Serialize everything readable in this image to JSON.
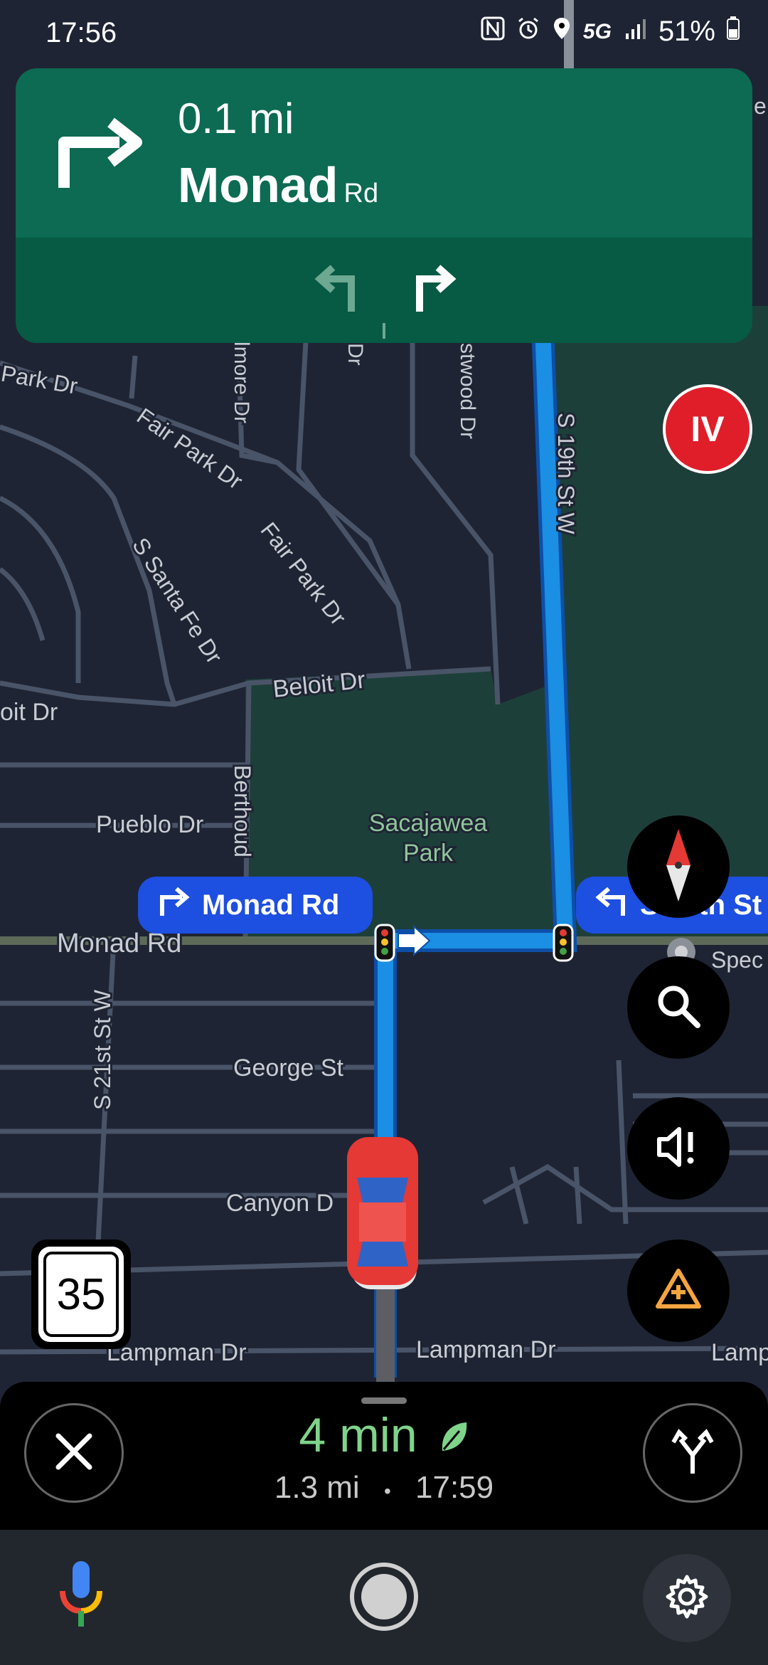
{
  "status_bar": {
    "time": "17:56",
    "network": "5G",
    "battery": "51%"
  },
  "navigation": {
    "distance": "0.1 mi",
    "street_name": "Monad",
    "street_suffix": "Rd"
  },
  "map": {
    "labels": {
      "park_dr": "Park Dr",
      "fair_park_dr_1": "Fair Park Dr",
      "fair_park_dr_2": "Fair Park Dr",
      "s_santa_fe_dr": "S Santa Fe Dr",
      "beloit_dr": "Beloit Dr",
      "beloit_dr_left": "oit Dr",
      "pueblo_dr": "Pueblo Dr",
      "berthoud": "Berthoud",
      "monad_rd": "Monad Rd",
      "s_21st_st_w": "S 21st St W",
      "george_st": "George St",
      "canyon_dr": "Canyon D",
      "lampman_dr_1": "Lampman Dr",
      "lampman_dr_2": "Lampman Dr",
      "lampman_dr_3": "Lamp",
      "s_19th_st_w": "S 19th St W",
      "gilmore_dr": "lmore Dr",
      "dr": "Dr",
      "eastwood_dr": "stwood Dr",
      "park_name_line1": "Sacajawea",
      "park_name_line2": "Park",
      "spec": "Spec",
      "edge_e": "e"
    },
    "turn_pill": "Monad Rd",
    "upcoming_pill": "S 19th St",
    "badge": "IV"
  },
  "speed_limit": "35",
  "trip": {
    "eta_minutes": "4 min",
    "distance": "1.3 mi",
    "separator": "•",
    "arrival": "17:59"
  },
  "colors": {
    "nav_green": "#0c6b52",
    "route_blue": "#1a8fe3",
    "eta_green": "#7fd48a",
    "map_bg": "#1e2433",
    "park": "#1d3f3a"
  }
}
